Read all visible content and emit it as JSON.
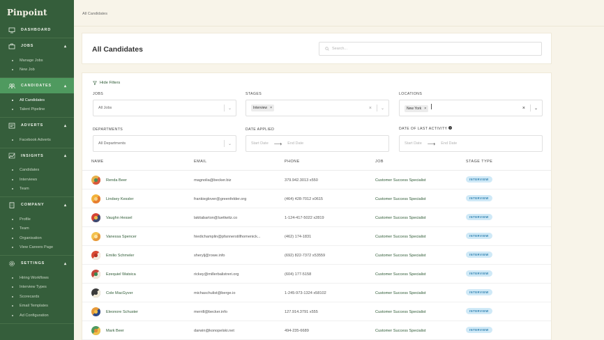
{
  "app": {
    "brand": "Pinpoint"
  },
  "breadcrumb": "All Candidates",
  "sidebar": {
    "sections": [
      {
        "label": "DASHBOARD",
        "icon": "monitor-icon",
        "expanded": false,
        "items": []
      },
      {
        "label": "JOBS",
        "icon": "briefcase-icon",
        "expanded": true,
        "items": [
          "Manage Jobs",
          "New Job"
        ]
      },
      {
        "label": "CANDIDATES",
        "icon": "people-icon",
        "expanded": true,
        "active": true,
        "items": [
          "All Candidates",
          "Talent Pipeline"
        ]
      },
      {
        "label": "ADVERTS",
        "icon": "advert-icon",
        "expanded": true,
        "items": [
          "Facebook Adverts"
        ]
      },
      {
        "label": "INSIGHTS",
        "icon": "insights-icon",
        "expanded": true,
        "items": [
          "Candidates",
          "Interviews",
          "Team"
        ]
      },
      {
        "label": "COMPANY",
        "icon": "building-icon",
        "expanded": true,
        "items": [
          "Profile",
          "Team",
          "Organisation",
          "View Careers Page"
        ]
      },
      {
        "label": "SETTINGS",
        "icon": "gear-icon",
        "expanded": true,
        "items": [
          "Hiring Workflows",
          "Interview Types",
          "Scorecards",
          "Email Templates",
          "Ad Configuration"
        ]
      }
    ],
    "current_item": "All Candidates"
  },
  "header": {
    "title": "All Candidates",
    "search_placeholder": "Search..."
  },
  "filters": {
    "toggle_label": "Hide Filters",
    "jobs": {
      "label": "JOBS",
      "value": "All Jobs"
    },
    "stages": {
      "label": "STAGES",
      "chips": [
        "Interview"
      ]
    },
    "locations": {
      "label": "LOCATIONS",
      "chips": [
        "New York"
      ]
    },
    "departments": {
      "label": "DEPARTMENTS",
      "value": "All Departments"
    },
    "date_applied": {
      "label": "DATE APPLIED",
      "start_placeholder": "Start Date",
      "end_placeholder": "End Date"
    },
    "last_activity": {
      "label": "DATE OF LAST ACTIVITY",
      "start_placeholder": "Start Date",
      "end_placeholder": "End Date"
    }
  },
  "table": {
    "columns": [
      "NAME",
      "EMAIL",
      "PHONE",
      "JOB",
      "STAGE TYPE"
    ],
    "rows": [
      {
        "name": "Renda Beer",
        "email": "magnolia@becker.biz",
        "phone": "379.942.3013 x550",
        "job": "Customer Success Specialist",
        "stage": "INTERVIEW",
        "avatar": [
          "#e8b04a",
          "#d9583c",
          "#4c8c5a"
        ]
      },
      {
        "name": "Lindsey Kessler",
        "email": "frankieglover@greenfelder.org",
        "phone": "(464) 428-7012 x0615",
        "job": "Customer Success Specialist",
        "stage": "INTERVIEW",
        "avatar": [
          "#f2b23a",
          "#e77d30",
          "#f4d188"
        ]
      },
      {
        "name": "Vaughn Hessel",
        "email": "lakitabarton@luettwitz.co",
        "phone": "1-124-417-5022 x2819",
        "job": "Customer Success Specialist",
        "stage": "INTERVIEW",
        "avatar": [
          "#d64436",
          "#3d4b73",
          "#e9b949"
        ]
      },
      {
        "name": "Vanessa Spencer",
        "email": "hiedichamplin@pfannerstillhomenick...",
        "phone": "(462) 174-1831",
        "job": "Customer Success Specialist",
        "stage": "INTERVIEW",
        "avatar": [
          "#f4c24d",
          "#e79a3c",
          "#fbe3a2"
        ]
      },
      {
        "name": "Emilio Schmeler",
        "email": "sherylj@rowe.info",
        "phone": "(692) 822-7372 x53559",
        "job": "Customer Success Specialist",
        "stage": "INTERVIEW",
        "avatar": [
          "#d94a33",
          "#f3ede0",
          "#b53527"
        ]
      },
      {
        "name": "Ezequiel Watsica",
        "email": "rickey@millerbalistreri.org",
        "phone": "(604) 177-5158",
        "job": "Customer Success Specialist",
        "stage": "INTERVIEW",
        "avatar": [
          "#c5463a",
          "#f1e9da",
          "#3d8a51"
        ]
      },
      {
        "name": "Cole MacGyver",
        "email": "michaschulist@berge.io",
        "phone": "1-245-973-1324 x58102",
        "job": "Customer Success Specialist",
        "stage": "INTERVIEW",
        "avatar": [
          "#3b3b3b",
          "#f3ecda",
          "#3b3b3b"
        ]
      },
      {
        "name": "Eleonore Schuster",
        "email": "merrill@becker.info",
        "phone": "127.914.3791 x555",
        "job": "Customer Success Specialist",
        "stage": "INTERVIEW",
        "avatar": [
          "#e79a38",
          "#2d4a8a",
          "#f0c04a"
        ]
      },
      {
        "name": "Mark Beer",
        "email": "darwin@konopelski.net",
        "phone": "494-235-6689",
        "job": "Customer Success Specialist",
        "stage": "INTERVIEW",
        "avatar": [
          "#4f9a5f",
          "#f0c04a",
          "#e08a35"
        ]
      }
    ]
  }
}
